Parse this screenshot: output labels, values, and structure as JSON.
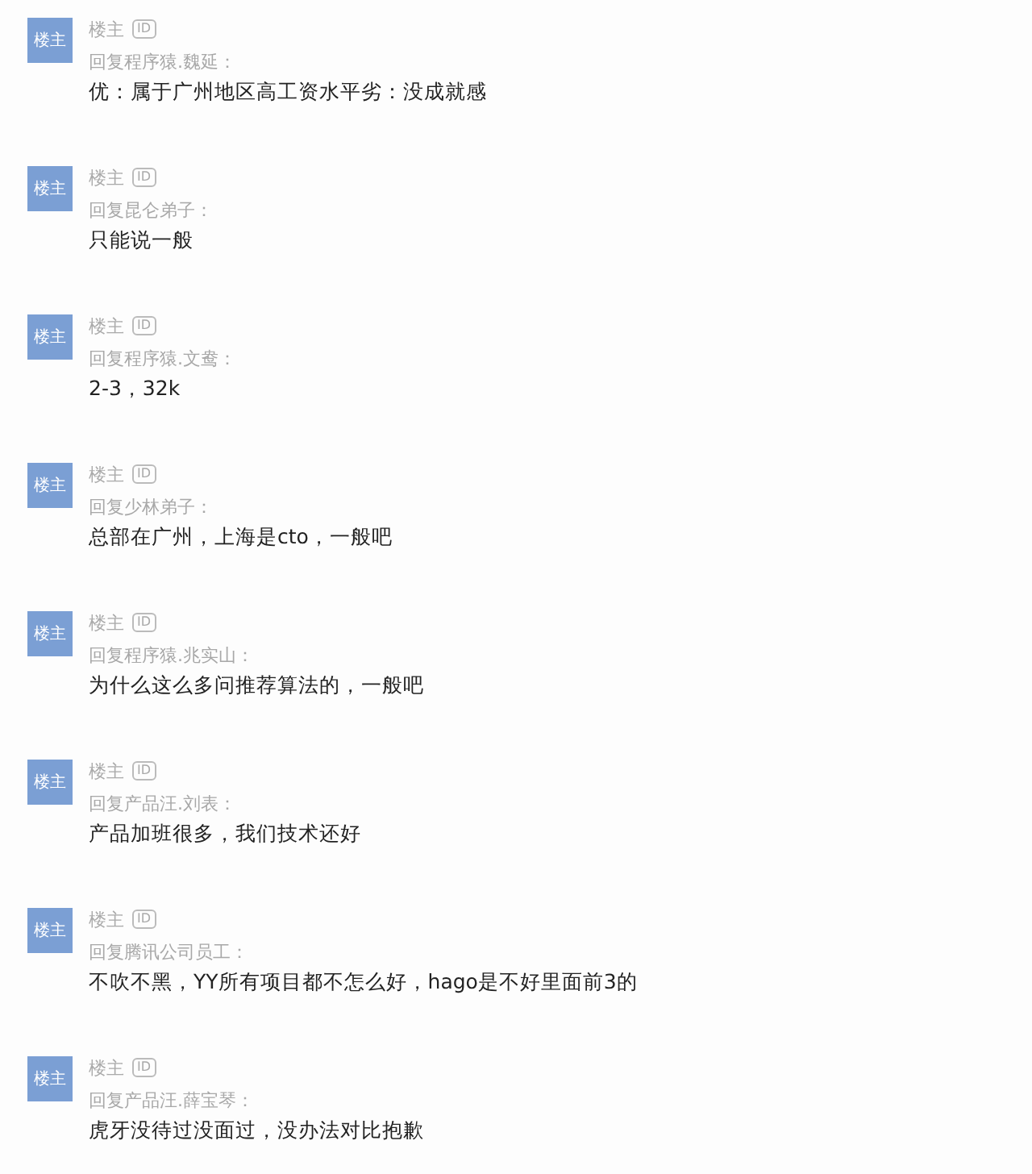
{
  "comments": [
    {
      "avatar": "楼主",
      "author": "楼主",
      "badge": "ID",
      "reply_to": "回复程序猿.魏延：",
      "content": "优：属于广州地区高工资水平劣：没成就感"
    },
    {
      "avatar": "楼主",
      "author": "楼主",
      "badge": "ID",
      "reply_to": "回复昆仑弟子：",
      "content": "只能说一般"
    },
    {
      "avatar": "楼主",
      "author": "楼主",
      "badge": "ID",
      "reply_to": "回复程序猿.文鸯：",
      "content": "2-3，32k"
    },
    {
      "avatar": "楼主",
      "author": "楼主",
      "badge": "ID",
      "reply_to": "回复少林弟子：",
      "content": "总部在广州，上海是cto，一般吧"
    },
    {
      "avatar": "楼主",
      "author": "楼主",
      "badge": "ID",
      "reply_to": "回复程序猿.兆实山：",
      "content": "为什么这么多问推荐算法的，一般吧"
    },
    {
      "avatar": "楼主",
      "author": "楼主",
      "badge": "ID",
      "reply_to": "回复产品汪.刘表：",
      "content": "产品加班很多，我们技术还好"
    },
    {
      "avatar": "楼主",
      "author": "楼主",
      "badge": "ID",
      "reply_to": "回复腾讯公司员工：",
      "content": "不吹不黑，YY所有项目都不怎么好，hago是不好里面前3的"
    },
    {
      "avatar": "楼主",
      "author": "楼主",
      "badge": "ID",
      "reply_to": "回复产品汪.薛宝琴：",
      "content": "虎牙没待过没面过，没办法对比抱歉"
    }
  ]
}
